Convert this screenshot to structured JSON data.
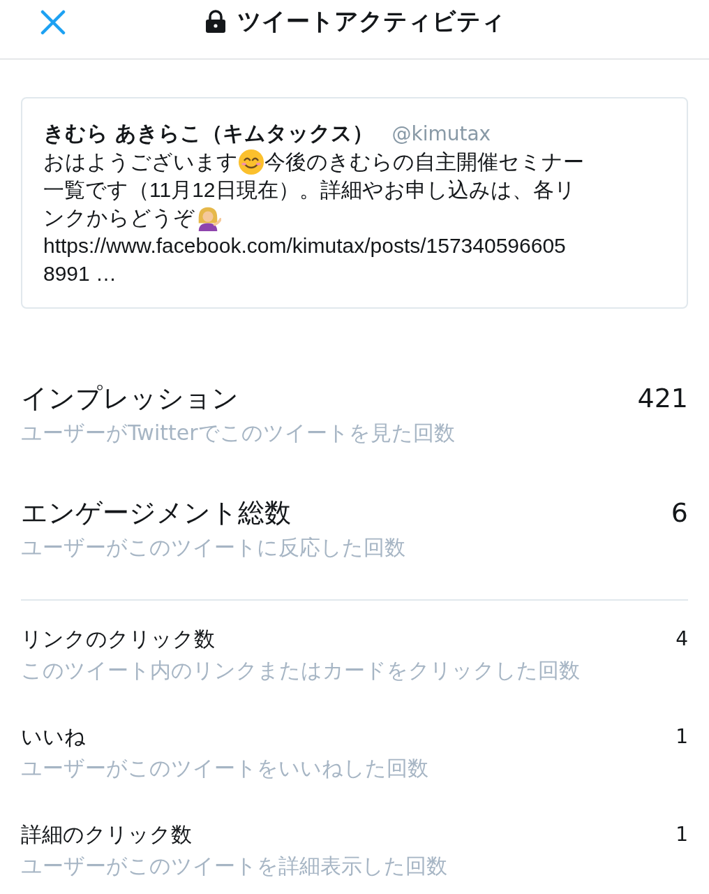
{
  "header": {
    "title": "ツイートアクティビティ"
  },
  "tweet": {
    "name": "きむら あきらこ（キムタックス）",
    "handle": "@kimutax",
    "lines": [
      [
        {
          "kind": "text",
          "text": "おはようございます"
        },
        {
          "kind": "smile"
        },
        {
          "kind": "text",
          "text": "今後のきむらの自主開催セミナー"
        }
      ],
      [
        {
          "kind": "text",
          "text": "一覧です（11月12日現在）。詳細やお申し込みは、各リ"
        }
      ],
      [
        {
          "kind": "text",
          "text": "ンクからどうぞ"
        },
        {
          "kind": "person"
        }
      ],
      [
        {
          "kind": "text",
          "text": "https://www.facebook.com/kimutax/posts/157340596605"
        }
      ],
      [
        {
          "kind": "text",
          "text": "8991 …"
        }
      ]
    ]
  },
  "metrics": [
    {
      "kind": "major",
      "label": "インプレッション",
      "description": "ユーザーがTwitterでこのツイートを見た回数",
      "value": "421"
    },
    {
      "kind": "major",
      "label": "エンゲージメント総数",
      "description": "ユーザーがこのツイートに反応した回数",
      "value": "6"
    },
    {
      "kind": "minor",
      "label": "リンクのクリック数",
      "description": "このツイート内のリンクまたはカードをクリックした回数",
      "value": "4"
    },
    {
      "kind": "minor",
      "label": "いいね",
      "description": "ユーザーがこのツイートをいいねした回数",
      "value": "1"
    },
    {
      "kind": "minor",
      "label": "詳細のクリック数",
      "description": "ユーザーがこのツイートを詳細表示した回数",
      "value": "1"
    }
  ]
}
